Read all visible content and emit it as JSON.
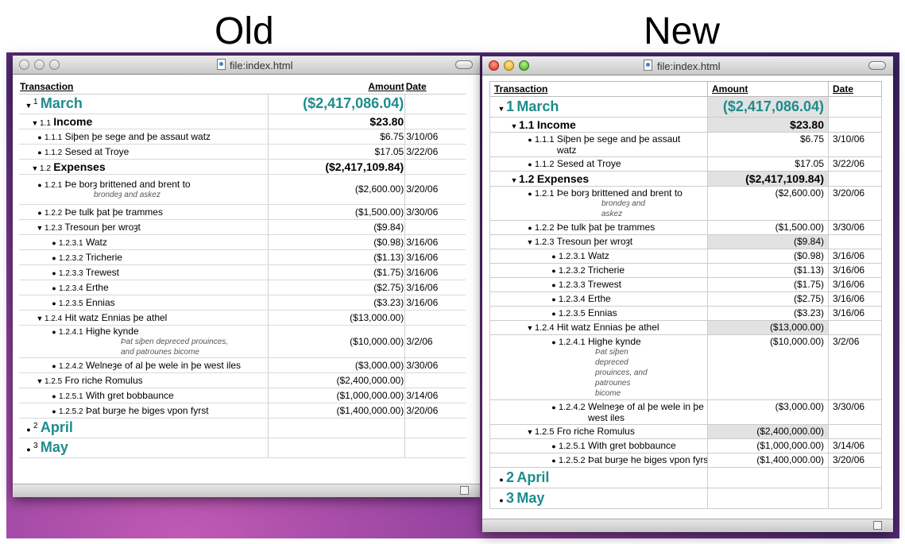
{
  "headings": {
    "old": "Old",
    "new": "New"
  },
  "window": {
    "title": "file:index.html"
  },
  "columns": {
    "transaction": "Transaction",
    "amount": "Amount",
    "date": "Date"
  },
  "rows": [
    {
      "num": "1",
      "label": "March",
      "amount": "($2,417,086.04)",
      "date": "",
      "level": 1
    },
    {
      "num": "1.1",
      "label": "Income",
      "amount": "$23.80",
      "date": "",
      "level": 2
    },
    {
      "num": "1.1.1",
      "label": "Siþen þe sege and þe assaut watz",
      "amount": "$6.75",
      "date": "3/10/06",
      "level": 3
    },
    {
      "num": "1.1.2",
      "label": "Sesed at Troye",
      "amount": "$17.05",
      "date": "3/22/06",
      "level": 3
    },
    {
      "num": "1.2",
      "label": "Expenses",
      "amount": "($2,417,109.84)",
      "date": "",
      "level": 2
    },
    {
      "num": "1.2.1",
      "label": "Þe borȝ brittened and brent to",
      "sub": "brondeȝ and askez",
      "amount": "($2,600.00)",
      "date": "3/20/06",
      "level": 3
    },
    {
      "num": "1.2.2",
      "label": "Þe tulk þat þe trammes",
      "amount": "($1,500.00)",
      "date": "3/30/06",
      "level": 3
    },
    {
      "num": "1.2.3",
      "label": "Tresoun þer wroȝt",
      "amount": "($9.84)",
      "date": "",
      "level": 3,
      "group": true
    },
    {
      "num": "1.2.3.1",
      "label": "Watz",
      "amount": "($0.98)",
      "date": "3/16/06",
      "level": 4
    },
    {
      "num": "1.2.3.2",
      "label": "Tricherie",
      "amount": "($1.13)",
      "date": "3/16/06",
      "level": 4
    },
    {
      "num": "1.2.3.3",
      "label": "Trewest",
      "amount": "($1.75)",
      "date": "3/16/06",
      "level": 4
    },
    {
      "num": "1.2.3.4",
      "label": "Erthe",
      "amount": "($2.75)",
      "date": "3/16/06",
      "level": 4
    },
    {
      "num": "1.2.3.5",
      "label": "Ennias",
      "amount": "($3.23)",
      "date": "3/16/06",
      "level": 4
    },
    {
      "num": "1.2.4",
      "label": "Hit watz Ennias þe athel",
      "amount": "($13,000.00)",
      "date": "",
      "level": 3,
      "group": true
    },
    {
      "num": "1.2.4.1",
      "label": "Highe kynde",
      "sub": "Þat siþen depreced prouinces, and patrounes bicome",
      "amount": "($10,000.00)",
      "date": "3/2/06",
      "level": 4
    },
    {
      "num": "1.2.4.2",
      "label": "Welneȝe of al þe wele in þe west iles",
      "amount": "($3,000.00)",
      "date": "3/30/06",
      "level": 4
    },
    {
      "num": "1.2.5",
      "label": "Fro riche Romulus",
      "amount": "($2,400,000.00)",
      "date": "",
      "level": 3,
      "group": true
    },
    {
      "num": "1.2.5.1",
      "label": "With gret bobbaunce",
      "amount": "($1,000,000.00)",
      "date": "3/14/06",
      "level": 4
    },
    {
      "num": "1.2.5.2",
      "label": "Þat burȝe he biges vpon fyrst",
      "amount": "($1,400,000.00)",
      "date": "3/20/06",
      "level": 4
    },
    {
      "num": "2",
      "label": "April",
      "amount": "",
      "date": "",
      "level": 1,
      "collapsed": true
    },
    {
      "num": "3",
      "label": "May",
      "amount": "",
      "date": "",
      "level": 1,
      "collapsed": true
    }
  ],
  "colors": {
    "month": "#1e8c8c",
    "highlight": "#e2e2e2"
  }
}
